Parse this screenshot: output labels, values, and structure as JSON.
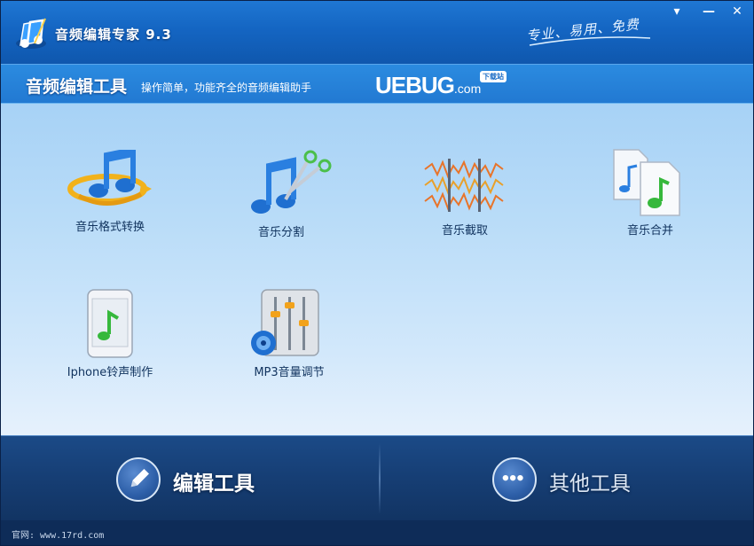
{
  "app": {
    "title": "音频编辑专家 9.3",
    "slogan": "专业、易用、免费"
  },
  "window_controls": {
    "menu": "▾",
    "minimize": "—",
    "close": "✕"
  },
  "header": {
    "title": "音频编辑工具",
    "description": "操作简单，功能齐全的音频编辑助手",
    "logo_main": "UEBUG",
    "logo_suffix": ".com",
    "logo_badge": "下载站"
  },
  "tools": [
    {
      "label": "音乐格式转换",
      "icon": "music-convert-icon"
    },
    {
      "label": "音乐分割",
      "icon": "music-split-icon"
    },
    {
      "label": "音乐截取",
      "icon": "music-trim-icon"
    },
    {
      "label": "音乐合并",
      "icon": "music-merge-icon"
    },
    {
      "label": "Iphone铃声制作",
      "icon": "iphone-ringtone-icon"
    },
    {
      "label": "MP3音量调节",
      "icon": "mp3-volume-icon"
    }
  ],
  "nav": {
    "edit_label": "编辑工具",
    "other_label": "其他工具"
  },
  "status": {
    "text": "官网: www.17rd.com"
  },
  "colors": {
    "titlebar": "#1465c2",
    "main_bg_top": "#a7d2f6",
    "main_bg_bottom": "#e6f1fc",
    "bottom_nav": "#163e74",
    "label_text": "#11335e"
  }
}
